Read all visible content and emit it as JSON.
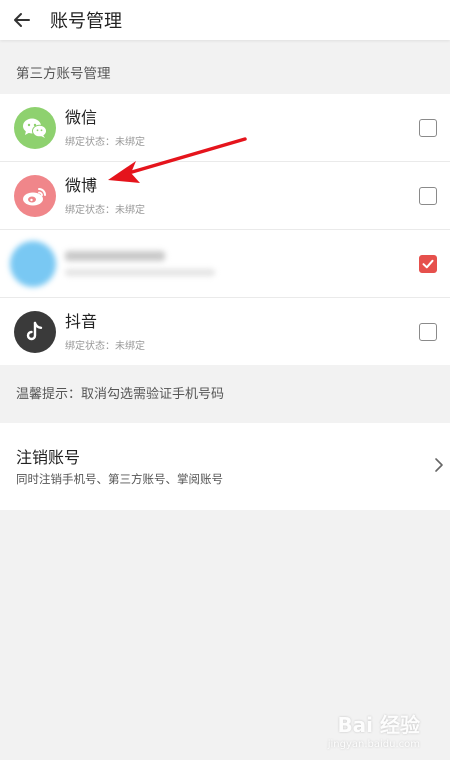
{
  "header": {
    "title": "账号管理"
  },
  "section": {
    "title": "第三方账号管理"
  },
  "accounts": [
    {
      "name": "微信",
      "status": "绑定状态：未绑定",
      "icon": "wechat-icon",
      "color": "#8ed16f",
      "checked": false
    },
    {
      "name": "微博",
      "status": "绑定状态：未绑定",
      "icon": "weibo-icon",
      "color": "#f0868a",
      "checked": false
    },
    {
      "name": "",
      "status": "",
      "icon": "blurred-account-icon",
      "color": "#79c8f3",
      "checked": true
    },
    {
      "name": "抖音",
      "status": "绑定状态：未绑定",
      "icon": "douyin-icon",
      "color": "#3a3a3a",
      "checked": false
    }
  ],
  "hint": "温馨提示：取消勾选需验证手机号码",
  "cancel": {
    "title": "注销账号",
    "desc": "同时注销手机号、第三方账号、掌阅账号"
  },
  "colors": {
    "accent": "#e6504c",
    "arrow": "#e5141c"
  },
  "watermark": {
    "main": "Bai 经验",
    "sub": "jingyan.baidu.com"
  }
}
